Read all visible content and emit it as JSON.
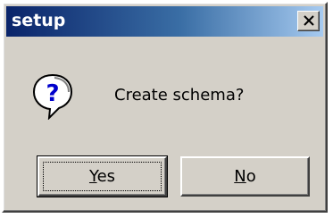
{
  "window": {
    "title": "setup"
  },
  "dialog": {
    "message": "Create schema?",
    "icon": "question-icon"
  },
  "buttons": {
    "yes": {
      "mnemonic": "Y",
      "rest": "es"
    },
    "no": {
      "mnemonic": "N",
      "rest": "o"
    }
  },
  "colors": {
    "titlebar_start": "#0a246a",
    "titlebar_end": "#a6caf0",
    "face": "#d4d0c8"
  }
}
